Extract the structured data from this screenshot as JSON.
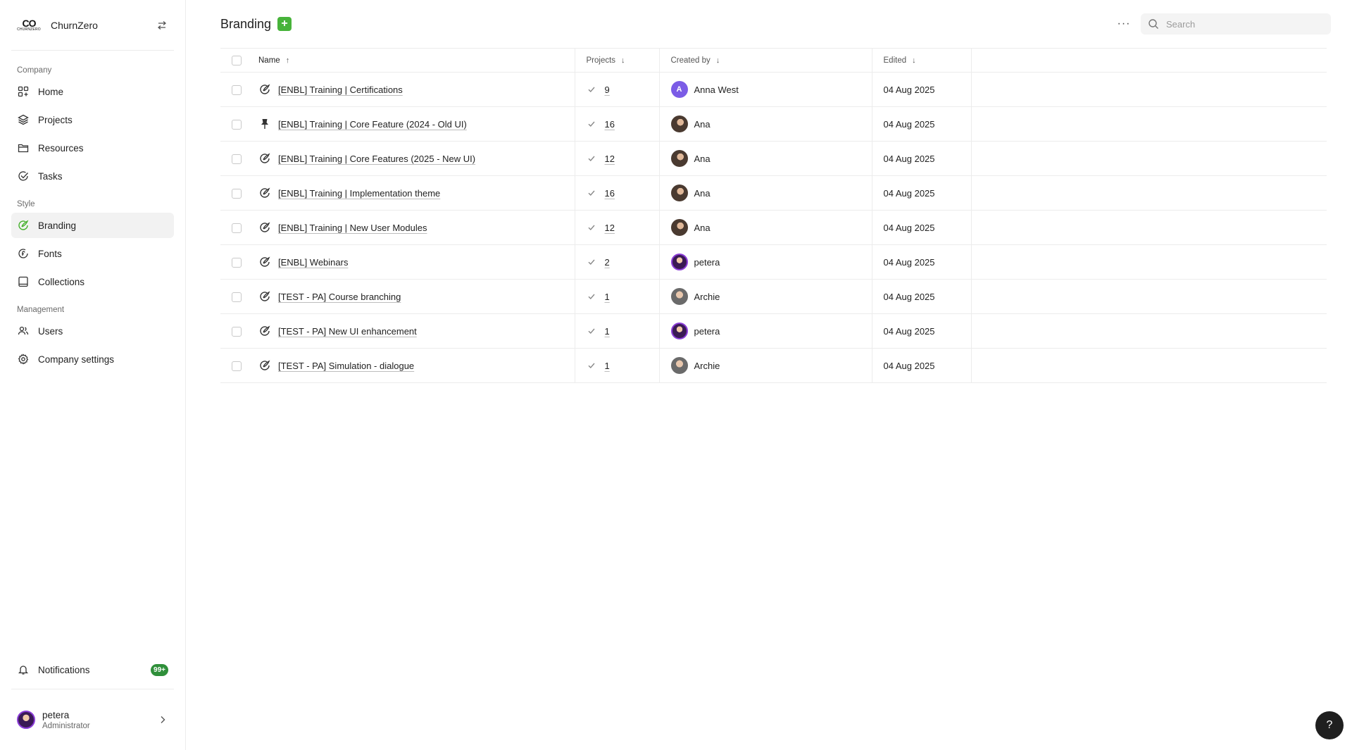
{
  "app": {
    "name": "ChurnZero",
    "logo_text": "CO",
    "logo_subtext": "CHURNZERO"
  },
  "sidebar": {
    "sections": [
      {
        "label": "Company",
        "items": [
          {
            "label": "Home",
            "icon": "grid-icon"
          },
          {
            "label": "Projects",
            "icon": "layers-icon"
          },
          {
            "label": "Resources",
            "icon": "folder-icon"
          },
          {
            "label": "Tasks",
            "icon": "check-circle-icon"
          }
        ]
      },
      {
        "label": "Style",
        "items": [
          {
            "label": "Branding",
            "icon": "palette-icon",
            "active": true
          },
          {
            "label": "Fonts",
            "icon": "font-icon"
          },
          {
            "label": "Collections",
            "icon": "book-icon"
          }
        ]
      },
      {
        "label": "Management",
        "items": [
          {
            "label": "Users",
            "icon": "users-icon"
          },
          {
            "label": "Company settings",
            "icon": "gear-icon"
          }
        ]
      }
    ],
    "notifications": {
      "label": "Notifications",
      "count": "99+"
    },
    "user": {
      "name": "petera",
      "role": "Administrator"
    }
  },
  "header": {
    "title": "Branding",
    "add_label": "+",
    "more_label": "···",
    "search": {
      "placeholder": "Search",
      "value": ""
    }
  },
  "table": {
    "columns": {
      "name": "Name",
      "projects": "Projects",
      "created_by": "Created by",
      "edited": "Edited"
    },
    "rows": [
      {
        "name": "[ENBL] Training | Certifications",
        "icon": "palette-icon",
        "projects": "9",
        "created_by": "Anna West",
        "avatar": "anna",
        "avatar_letter": "A",
        "edited": "04 Aug 2025"
      },
      {
        "name": "[ENBL] Training | Core Feature (2024 - Old UI)",
        "icon": "pin-icon",
        "projects": "16",
        "created_by": "Ana",
        "avatar": "ana",
        "avatar_letter": "",
        "edited": "04 Aug 2025"
      },
      {
        "name": "[ENBL] Training | Core Features (2025 - New UI)",
        "icon": "palette-icon",
        "projects": "12",
        "created_by": "Ana",
        "avatar": "ana",
        "avatar_letter": "",
        "edited": "04 Aug 2025"
      },
      {
        "name": "[ENBL] Training | Implementation theme",
        "icon": "palette-icon",
        "projects": "16",
        "created_by": "Ana",
        "avatar": "ana",
        "avatar_letter": "",
        "edited": "04 Aug 2025"
      },
      {
        "name": "[ENBL] Training | New User Modules",
        "icon": "palette-icon",
        "projects": "12",
        "created_by": "Ana",
        "avatar": "ana",
        "avatar_letter": "",
        "edited": "04 Aug 2025"
      },
      {
        "name": "[ENBL] Webinars",
        "icon": "palette-icon",
        "projects": "2",
        "created_by": "petera",
        "avatar": "petera",
        "avatar_letter": "",
        "edited": "04 Aug 2025"
      },
      {
        "name": "[TEST - PA] Course branching",
        "icon": "palette-icon",
        "projects": "1",
        "created_by": "Archie",
        "avatar": "archie",
        "avatar_letter": "",
        "edited": "04 Aug 2025"
      },
      {
        "name": "[TEST - PA] New UI enhancement",
        "icon": "palette-icon",
        "projects": "1",
        "created_by": "petera",
        "avatar": "petera",
        "avatar_letter": "",
        "edited": "04 Aug 2025"
      },
      {
        "name": "[TEST - PA] Simulation - dialogue",
        "icon": "palette-icon",
        "projects": "1",
        "created_by": "Archie",
        "avatar": "archie",
        "avatar_letter": "",
        "edited": "04 Aug 2025"
      }
    ]
  },
  "help": {
    "label": "?"
  },
  "colors": {
    "accent": "#43b02a",
    "badge": "#2f8f3a",
    "help_button": "#1f1f1f"
  }
}
